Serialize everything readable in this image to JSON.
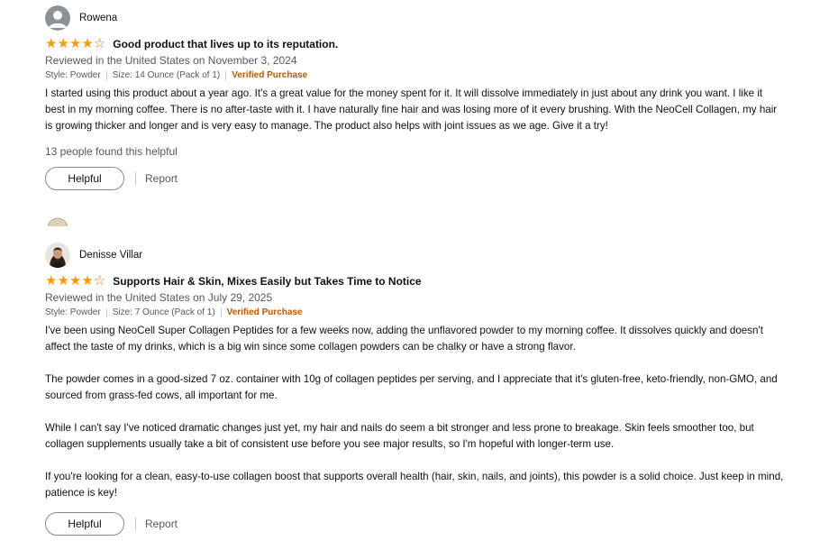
{
  "reviews": [
    {
      "reviewer": "Rowena",
      "rating": 4,
      "rating_max": 5,
      "title": "Good product that lives up to its reputation.",
      "date": "Reviewed in the United States on November 3, 2024",
      "style": "Style: Powder",
      "size": "Size: 14 Ounce (Pack of 1)",
      "verified": "Verified Purchase",
      "body": [
        "I started using this product about a year ago. It's a great value for the money spent for it. It will dissolve immediately in just about any drink you want. I like it best in my morning coffee. There is no after-taste with it. I have naturally fine hair and was losing more of it every brushing. With the NeoCell Collagen, my hair is growing thicker and longer and is very easy to manage. The product also helps with joint issues as we age. Give it a try!"
      ],
      "helpful_count": "13 people found this helpful",
      "helpful_label": "Helpful",
      "report_label": "Report"
    },
    {
      "reviewer": "Denisse Villar",
      "rating": 4,
      "rating_max": 5,
      "title": "Supports Hair & Skin, Mixes Easily but Takes Time to Notice",
      "date": "Reviewed in the United States on July 29, 2025",
      "style": "Style: Powder",
      "size": "Size: 7 Ounce (Pack of 1)",
      "verified": "Verified Purchase",
      "body": [
        "I've been using NeoCell Super Collagen Peptides for a few weeks now, adding the unflavored powder to my morning coffee. It dissolves quickly and doesn't affect the taste of my drinks, which is a big win since some collagen powders can be chalky or have a strong flavor.",
        "The powder comes in a good-sized 7 oz. container with 10g of collagen peptides per serving, and I appreciate that it's gluten-free, keto-friendly, non-GMO, and sourced from grass-fed cows, all important for me.",
        "While I can't say I've noticed dramatic changes just yet, my hair and nails do seem a bit stronger and less prone to breakage. Skin feels smoother too, but collagen supplements usually take a bit of consistent use before you see major results, so I'm hopeful with longer-term use.",
        "If you're looking for a clean, easy-to-use collagen boost that supports overall health (hair, skin, nails, and joints), this powder is a solid choice. Just keep in mind, patience is key!"
      ],
      "helpful_label": "Helpful",
      "report_label": "Report"
    }
  ],
  "colors": {
    "star": "#ff9a00",
    "verified": "#c45500",
    "muted": "#565959"
  },
  "icons": {
    "default_avatar": "person-silhouette-icon",
    "photo_avatar": "user-photo-avatar"
  }
}
